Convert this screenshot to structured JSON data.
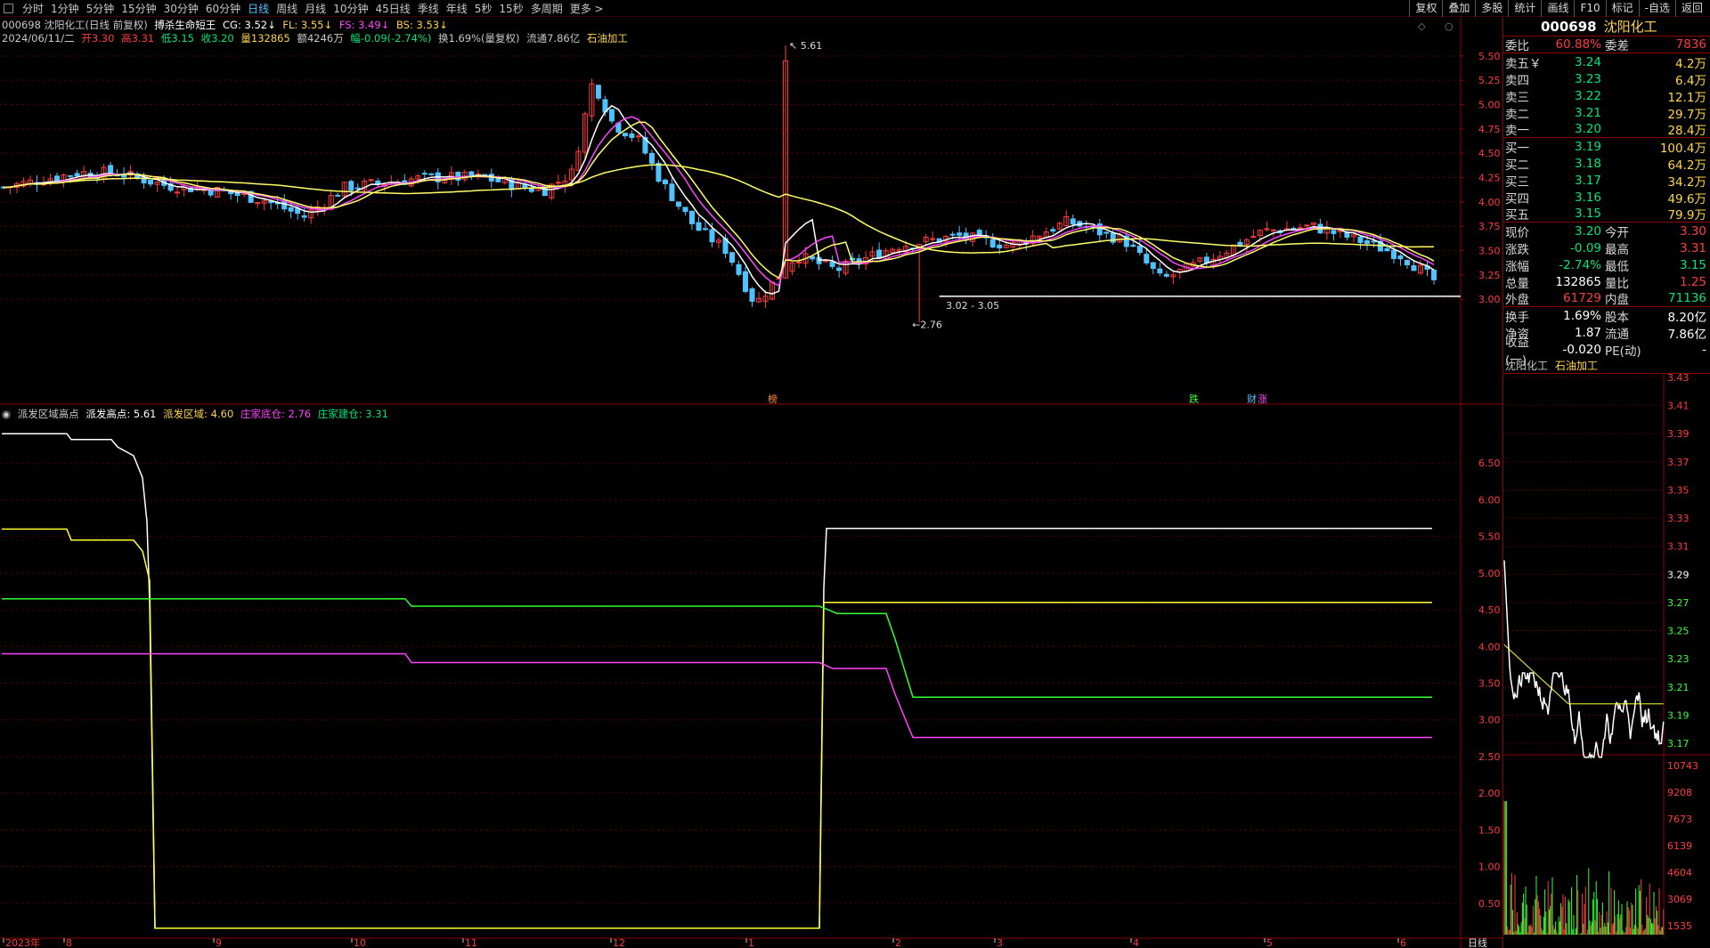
{
  "toolbar": {
    "periods": [
      "分时",
      "1分钟",
      "5分钟",
      "15分钟",
      "30分钟",
      "60分钟",
      "日线",
      "周线",
      "月线",
      "10分钟",
      "45日线",
      "季线",
      "年线",
      "5秒",
      "15秒",
      "多周期",
      "更多 >"
    ],
    "active_period": "日线",
    "tools": [
      "复权",
      "叠加",
      "多股",
      "统计",
      "画线",
      "F10",
      "标记",
      "-自选",
      "返回"
    ]
  },
  "stock": {
    "code": "000698",
    "name": "沈阳化工",
    "sector": "石油加工"
  },
  "main_panel": {
    "title_line": {
      "stock": "000698 沈阳化工(日线 前复权)",
      "indicator": "搏杀生命短王",
      "cg": "CG: 3.52↓",
      "fl": "FL: 3.55↓",
      "fs": "FS: 3.49↓",
      "bs": "BS: 3.53↓"
    },
    "ohlc_line": {
      "date": "2024/06/11/二",
      "open": "开3.30",
      "high": "高3.31",
      "low": "低3.15",
      "close": "收3.20",
      "vol": "量132865",
      "amount": "额4246万",
      "change": "幅-0.09(-2.74%)",
      "turnover": "换1.69%(量复权)",
      "float": "流通7.86亿",
      "sector": "石油加工"
    },
    "y_ticks": [
      "5.50",
      "5.25",
      "5.00",
      "4.75",
      "4.50",
      "4.25",
      "4.00",
      "3.75",
      "3.50",
      "3.25",
      "3.00"
    ],
    "annotations": {
      "high": "5.61",
      "low": "2.76",
      "range": "3.02 - 3.05"
    },
    "markers": [
      "榜",
      "跌",
      "财",
      "涨"
    ]
  },
  "sub_panel": {
    "legend": {
      "name": "派发区域高点",
      "item1": "派发高点: 5.61",
      "item2": "派发区域: 4.60",
      "item3": "庄家底仓: 2.76",
      "item4": "庄家建仓: 3.31"
    },
    "y_ticks": [
      "6.50",
      "6.00",
      "5.50",
      "5.00",
      "4.50",
      "4.00",
      "3.50",
      "3.00",
      "2.50",
      "2.00",
      "1.50",
      "1.00",
      "0.50"
    ]
  },
  "x_axis": {
    "labels": [
      "2023年",
      "8",
      "9",
      "10",
      "11",
      "12",
      "1",
      "2",
      "3",
      "4",
      "5",
      "6"
    ],
    "period_label": "日线"
  },
  "quote_panel": {
    "wb": {
      "label": "委比",
      "value": "60.88%",
      "label2": "委差",
      "value2": "7836"
    },
    "asks": [
      {
        "label": "卖五￥",
        "price": "3.24",
        "vol": "4.2万"
      },
      {
        "label": "卖四",
        "price": "3.23",
        "vol": "6.4万"
      },
      {
        "label": "卖三",
        "price": "3.22",
        "vol": "12.1万"
      },
      {
        "label": "卖二",
        "price": "3.21",
        "vol": "29.7万"
      },
      {
        "label": "卖一",
        "price": "3.20",
        "vol": "28.4万"
      }
    ],
    "bids": [
      {
        "label": "买一",
        "price": "3.19",
        "vol": "100.4万"
      },
      {
        "label": "买二",
        "price": "3.18",
        "vol": "64.2万"
      },
      {
        "label": "买三",
        "price": "3.17",
        "vol": "34.2万"
      },
      {
        "label": "买四",
        "price": "3.16",
        "vol": "49.6万"
      },
      {
        "label": "买五",
        "price": "3.15",
        "vol": "79.9万"
      }
    ],
    "stats": [
      {
        "l1": "现价",
        "v1": "3.20",
        "l2": "今开",
        "v2": "3.30"
      },
      {
        "l1": "涨跌",
        "v1": "-0.09",
        "l2": "最高",
        "v2": "3.31"
      },
      {
        "l1": "涨幅",
        "v1": "-2.74%",
        "l2": "最低",
        "v2": "3.15"
      },
      {
        "l1": "总量",
        "v1": "132865",
        "l2": "量比",
        "v2": "1.25"
      },
      {
        "l1": "外盘",
        "v1": "61729",
        "l2": "内盘",
        "v2": "71136"
      }
    ],
    "stats2": [
      {
        "l1": "换手",
        "v1": "1.69%",
        "l2": "股本",
        "v2": "8.20亿"
      },
      {
        "l1": "净资",
        "v1": "1.87",
        "l2": "流通",
        "v2": "7.86亿"
      },
      {
        "l1": "收益(一)",
        "v1": "-0.020",
        "l2": "PE(动)",
        "v2": "-"
      }
    ],
    "mini_tags": {
      "name": "沈阳化工",
      "sector": "石油加工"
    },
    "mini_price_ticks": [
      "3.43",
      "3.41",
      "3.39",
      "3.37",
      "3.35",
      "3.33",
      "3.31",
      "3.29",
      "3.27",
      "3.25",
      "3.23",
      "3.21",
      "3.19",
      "3.17"
    ],
    "mini_vol_ticks": [
      "10743",
      "9208",
      "7673",
      "6139",
      "4604",
      "3069",
      "1535"
    ]
  },
  "chart_data": {
    "type": "candlestick",
    "period": "daily",
    "x_labels": [
      "2023年",
      "8",
      "9",
      "10",
      "11",
      "12",
      "1",
      "2",
      "3",
      "4",
      "5",
      "6"
    ],
    "ylim": [
      2.7,
      5.7
    ],
    "key_values": {
      "period_high": 5.61,
      "period_low": 2.76,
      "last_close": 3.2
    },
    "sub_indicator": {
      "series": [
        {
          "name": "派发高点",
          "last": 5.61,
          "color": "#ffffff"
        },
        {
          "name": "派发区域",
          "last": 4.6,
          "color": "#ffff33"
        },
        {
          "name": "庄家底仓",
          "last": 2.76,
          "color": "#ff44ff"
        },
        {
          "name": "庄家建仓",
          "last": 3.31,
          "color": "#33ff33"
        }
      ],
      "ylim": [
        0,
        7
      ]
    }
  },
  "colors": {
    "up": "#ff3c3c",
    "down": "#4fc3ff",
    "grid": "#8b0000",
    "ma1": "#ffff66",
    "ma2": "#ffffff",
    "ma3": "#ff44ff"
  }
}
